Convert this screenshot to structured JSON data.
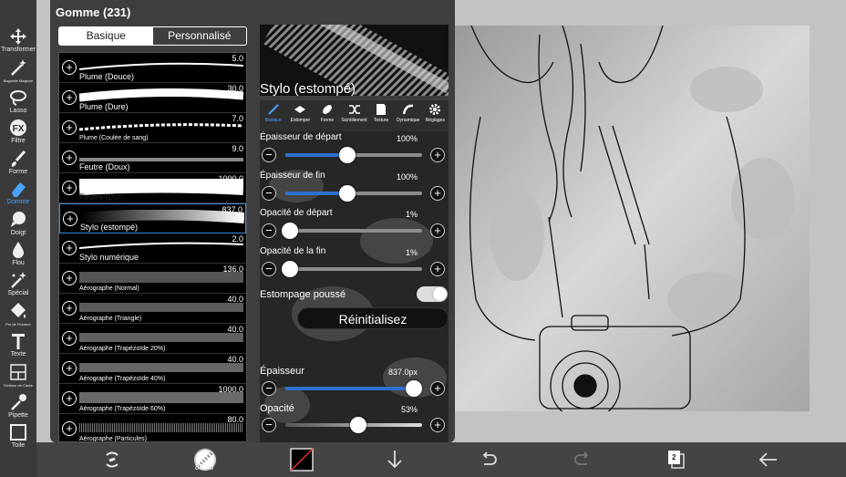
{
  "panel": {
    "title": "Gomme (231)",
    "tabs": {
      "basic": "Basique",
      "custom": "Personnalisé"
    }
  },
  "left_toolbar": [
    {
      "label": "Transformer",
      "icon": "move-icon"
    },
    {
      "label": "Baguette Magique",
      "icon": "magic-wand-icon"
    },
    {
      "label": "Lasso",
      "icon": "lasso-icon"
    },
    {
      "label": "Filtre",
      "icon": "fx-icon"
    },
    {
      "label": "Forme",
      "icon": "brush-icon"
    },
    {
      "label": "Gomme",
      "icon": "eraser-icon",
      "active": true
    },
    {
      "label": "Doigt",
      "icon": "finger-icon"
    },
    {
      "label": "Flou",
      "icon": "drop-icon"
    },
    {
      "label": "Spécial",
      "icon": "sparkle-icon"
    },
    {
      "label": "Pot de Peinture",
      "icon": "bucket-icon"
    },
    {
      "label": "Texte",
      "icon": "text-icon"
    },
    {
      "label": "Diviseur de Cadre",
      "icon": "frame-divider-icon"
    },
    {
      "label": "Pipette",
      "icon": "eyedropper-icon"
    },
    {
      "label": "Toile",
      "icon": "canvas-icon"
    }
  ],
  "brushes": [
    {
      "name": "Plume (Douce)",
      "size": "5.0"
    },
    {
      "name": "Plume (Dure)",
      "size": "30.0"
    },
    {
      "name": "Plume (Coulée de sang)",
      "size": "7.0"
    },
    {
      "name": "Feutre (Doux)",
      "size": "9.0"
    },
    {
      "name": "Feutre (Dur)",
      "size": "1000.0"
    },
    {
      "name": "Stylo (estompé)",
      "size": "837.0",
      "selected": true
    },
    {
      "name": "Stylo numérique",
      "size": "2.0"
    },
    {
      "name": "Aérographe (Normal)",
      "size": "136.0"
    },
    {
      "name": "Aérographe (Triangle)",
      "size": "40.0"
    },
    {
      "name": "Aérographe (Trapézoïde 20%)",
      "size": "40.0"
    },
    {
      "name": "Aérographe (Trapézoïde 40%)",
      "size": "40.0"
    },
    {
      "name": "Aérographe (Trapézoïde 60%)",
      "size": "1000.0"
    },
    {
      "name": "Aérographe (Particules)",
      "size": "80.0"
    }
  ],
  "settings": {
    "brush_title": "Stylo (estompé)",
    "tabs": [
      {
        "label": "Basique",
        "icon": "pen-icon",
        "active": true
      },
      {
        "label": "Estomper",
        "icon": "diamond-icon"
      },
      {
        "label": "Forme",
        "icon": "leaf-icon"
      },
      {
        "label": "Scintillement",
        "icon": "shuffle-icon"
      },
      {
        "label": "Texture",
        "icon": "texture-icon"
      },
      {
        "label": "Dynamique",
        "icon": "dynamics-icon"
      },
      {
        "label": "Réglages",
        "icon": "gear-icon"
      }
    ],
    "start_thickness": {
      "label": "Épaisseur de départ",
      "value": "100%",
      "fraction": 0.45
    },
    "end_thickness": {
      "label": "Épaisseur de fin",
      "value": "100%",
      "fraction": 0.45
    },
    "start_opacity": {
      "label": "Opacité de départ",
      "value": "1%",
      "fraction": 0.03
    },
    "end_opacity": {
      "label": "Opacité de la fin",
      "value": "1%",
      "fraction": 0.03
    },
    "smudge": {
      "label": "Estompage poussé",
      "on": true
    },
    "reset_label": "Réinitialisez",
    "thickness": {
      "label": "Épaisseur",
      "value": "837.0px",
      "fraction": 0.94
    },
    "opacity": {
      "label": "Opacité",
      "value": "53%",
      "fraction": 0.53
    }
  },
  "bottom_bar": {
    "brush_size": "837.0",
    "layer_count": "2"
  },
  "colors": {
    "accent": "#2f6fcf",
    "active_tool": "#4aa3ff",
    "panel": "#3e3e3e"
  }
}
